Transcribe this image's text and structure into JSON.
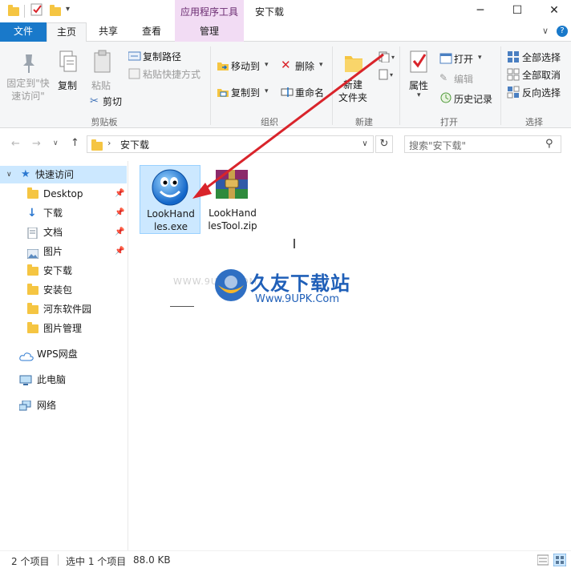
{
  "window": {
    "title": "安下载",
    "context_group": "应用程序工具",
    "minimize": "─",
    "maximize": "☐",
    "close": "✕"
  },
  "ribbon_tabs": {
    "file": "文件",
    "home": "主页",
    "share": "共享",
    "view": "查看",
    "manage": "管理"
  },
  "clipboard": {
    "pin": "固定到\"快速访问\"",
    "copy": "复制",
    "paste": "粘贴",
    "copy_path": "复制路径",
    "paste_shortcut": "粘贴快捷方式",
    "cut": "剪切",
    "label": "剪贴板"
  },
  "organize": {
    "move_to": "移动到",
    "delete": "删除",
    "copy_to": "复制到",
    "rename": "重命名",
    "label": "组织"
  },
  "new": {
    "new_folder": "新建\n文件夹",
    "label": "新建"
  },
  "open": {
    "properties": "属性",
    "open": "打开",
    "edit": "编辑",
    "history": "历史记录",
    "label": "打开"
  },
  "select": {
    "select_all": "全部选择",
    "select_none": "全部取消",
    "invert": "反向选择",
    "label": "选择"
  },
  "address": {
    "path": "安下载",
    "search_placeholder": "搜索\"安下载\""
  },
  "sidebar": {
    "items": [
      {
        "label": "快速访问",
        "icon": "star-icon"
      },
      {
        "label": "Desktop",
        "icon": "folder-icon",
        "pinned": true
      },
      {
        "label": "下载",
        "icon": "download-icon",
        "pinned": true
      },
      {
        "label": "文档",
        "icon": "document-icon",
        "pinned": true
      },
      {
        "label": "图片",
        "icon": "picture-icon",
        "pinned": true
      },
      {
        "label": "安下载",
        "icon": "folder-icon"
      },
      {
        "label": "安装包",
        "icon": "folder-icon"
      },
      {
        "label": "河东软件园",
        "icon": "folder-icon"
      },
      {
        "label": "图片管理",
        "icon": "folder-icon"
      },
      {
        "label": "WPS网盘",
        "icon": "cloud-icon"
      },
      {
        "label": "此电脑",
        "icon": "computer-icon"
      },
      {
        "label": "网络",
        "icon": "network-icon"
      }
    ]
  },
  "files": [
    {
      "name": "LookHandles.exe",
      "display": "LookHand\nles.exe",
      "selected": true,
      "icon": "exe-app-icon"
    },
    {
      "name": "LookHandlesTool.zip",
      "display": "LookHand\nlesTool.zip",
      "selected": false,
      "icon": "winrar-archive-icon"
    }
  ],
  "watermark": {
    "brand": "久友下载站",
    "url": "Www.9UPK.Com",
    "faint": "WWW.9UPK.COM"
  },
  "status": {
    "count": "2 个项目",
    "selection": "选中 1 个项目",
    "size": "88.0 KB"
  },
  "colors": {
    "accent": "#1979ca",
    "selection": "#cce8ff",
    "context_tab": "#f2dcf4",
    "arrow": "#d9242b"
  }
}
